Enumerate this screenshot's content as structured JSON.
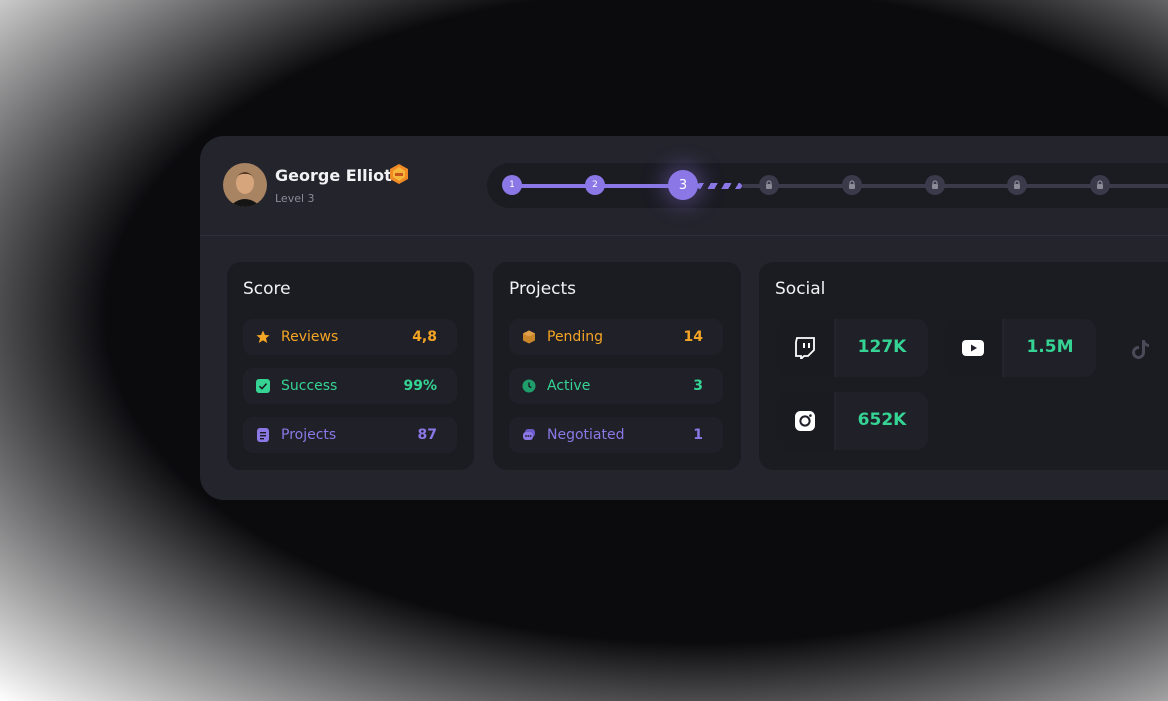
{
  "user": {
    "name": "George Elliot",
    "level": "Level 3"
  },
  "progress": {
    "steps": [
      "1",
      "2",
      "3"
    ],
    "current": 3,
    "locked_count": 5
  },
  "score": {
    "title": "Score",
    "items": [
      {
        "label": "Reviews",
        "value": "4,8",
        "icon": "star-icon",
        "color": "#f5a524"
      },
      {
        "label": "Success",
        "value": "99%",
        "icon": "check-icon",
        "color": "#35d494"
      },
      {
        "label": "Projects",
        "value": "87",
        "icon": "document-icon",
        "color": "#8b78e6"
      }
    ]
  },
  "projects": {
    "title": "Projects",
    "items": [
      {
        "label": "Pending",
        "value": "14",
        "icon": "box-icon",
        "color": "#f5a524"
      },
      {
        "label": "Active",
        "value": "3",
        "icon": "clock-icon",
        "color": "#35d494"
      },
      {
        "label": "Negotiated",
        "value": "1",
        "icon": "chat-icon",
        "color": "#8b78e6"
      }
    ]
  },
  "social": {
    "title": "Social",
    "items": [
      {
        "platform": "twitch-icon",
        "value": "127K"
      },
      {
        "platform": "youtube-icon",
        "value": "1.5M"
      },
      {
        "platform": "tiktok-icon",
        "value": ""
      },
      {
        "platform": "instagram-icon",
        "value": "652K"
      }
    ]
  }
}
